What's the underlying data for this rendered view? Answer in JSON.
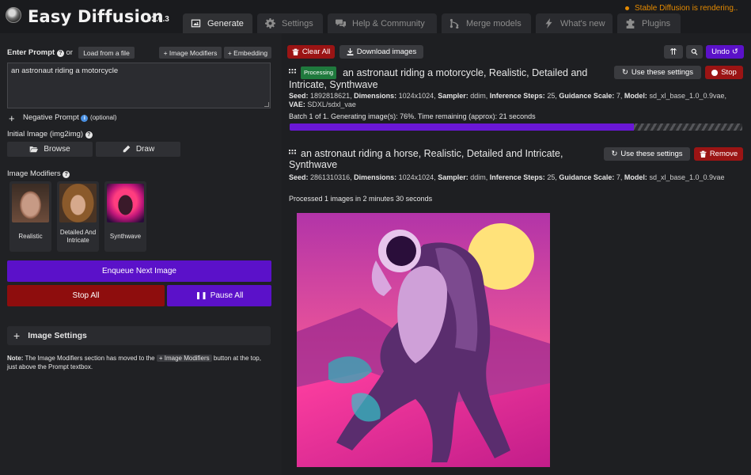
{
  "header": {
    "app_title": "Easy Diffusion",
    "version": "v3.0.3",
    "status": "Stable Diffusion is rendering..",
    "tabs": [
      {
        "label": "Generate",
        "icon": "image-icon",
        "active": true
      },
      {
        "label": "Settings",
        "icon": "gear-icon",
        "active": false
      },
      {
        "label": "Help & Community",
        "icon": "comments-icon",
        "active": false
      },
      {
        "label": "Merge models",
        "icon": "code-merge-icon",
        "active": false
      },
      {
        "label": "What's new",
        "icon": "bolt-icon",
        "active": false
      },
      {
        "label": "Plugins",
        "icon": "puzzle-icon",
        "active": false
      }
    ]
  },
  "left": {
    "prompt_label": "Enter Prompt",
    "or_text": "or",
    "load_file_label": "Load from a file",
    "image_modifiers_btn": "+ Image Modifiers",
    "embedding_btn": "+ Embedding",
    "prompt_value": "an astronaut riding a motorcycle",
    "negative_prompt_label": "Negative Prompt",
    "optional": "(optional)",
    "initial_image_label": "Initial Image (img2img)",
    "browse_label": "Browse",
    "draw_label": "Draw",
    "image_modifiers_label": "Image Modifiers",
    "modifiers": [
      {
        "name": "Realistic"
      },
      {
        "name": "Detailed And Intricate"
      },
      {
        "name": "Synthwave"
      }
    ],
    "enqueue_label": "Enqueue Next Image",
    "stop_all_label": "Stop All",
    "pause_all_label": "Pause All",
    "image_settings_label": "Image Settings",
    "note_prefix": "Note:",
    "note_text_1": "The Image Modifiers section has moved to the",
    "note_chip": "+ Image Modifiers",
    "note_text_2": "button at the top, just above the Prompt textbox."
  },
  "right": {
    "clear_all_label": "Clear All",
    "download_images_label": "Download images",
    "undo_label": "Undo",
    "task1": {
      "badge": "Processing",
      "title": "an astronaut riding a motorcycle, Realistic, Detailed and Intricate, Synthwave",
      "use_settings_label": "Use these settings",
      "stop_label": "Stop",
      "seed": "1892818621",
      "dimensions": "1024x1024",
      "sampler": "ddim",
      "inference_steps": "25",
      "guidance_scale": "7",
      "model": "sd_xl_base_1.0_0.9vae",
      "vae": "SDXL/sdxl_vae",
      "progress_text": "Batch 1 of 1. Generating image(s): 76%. Time remaining (approx): 21 seconds",
      "progress": 0.76
    },
    "task2": {
      "title": "an astronaut riding a horse, Realistic, Detailed and Intricate, Synthwave",
      "use_settings_label": "Use these settings",
      "remove_label": "Remove",
      "seed": "2861310316",
      "dimensions": "1024x1024",
      "sampler": "ddim",
      "inference_steps": "25",
      "guidance_scale": "7",
      "model": "sd_xl_base_1.0_0.9vae",
      "status_text": "Processed 1 images in 2 minutes 30 seconds"
    },
    "meta_labels": {
      "seed": "Seed:",
      "dimensions": "Dimensions:",
      "sampler": "Sampler:",
      "inference_steps": "Inference Steps:",
      "guidance_scale": "Guidance Scale:",
      "model": "Model:",
      "vae": "VAE:"
    }
  },
  "colors": {
    "accent_purple": "#6a17d6",
    "stop_red": "#b3261e",
    "processing_green": "#1f7a3d",
    "status_orange": "#e58a00"
  }
}
